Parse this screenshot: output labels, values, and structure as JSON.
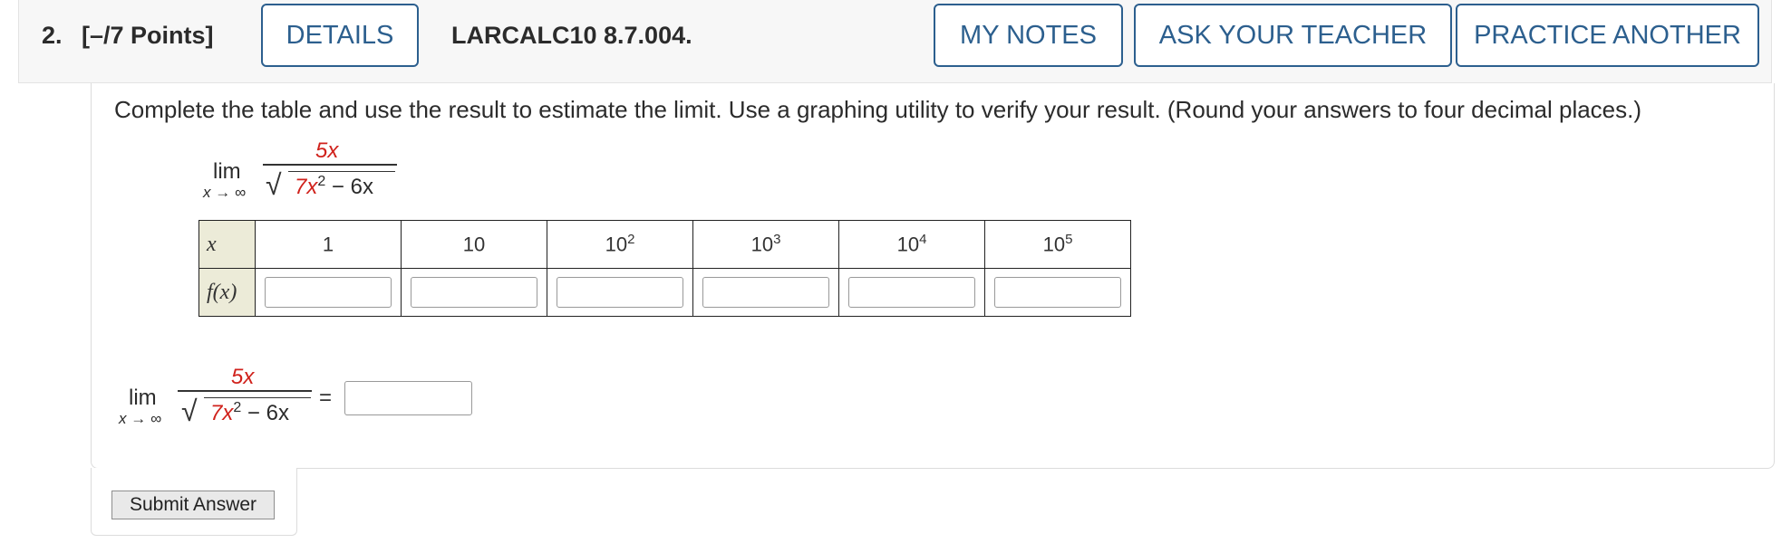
{
  "header": {
    "question_number": "2.",
    "points": "[–/7 Points]",
    "details_label": "DETAILS",
    "problem_code": "LARCALC10 8.7.004.",
    "my_notes_label": "MY NOTES",
    "ask_teacher_label": "ASK YOUR TEACHER",
    "practice_another_label": "PRACTICE ANOTHER"
  },
  "instructions": "Complete the table and use the result to estimate the limit. Use a graphing utility to verify your result. (Round your answers to four decimal places.)",
  "limit": {
    "lim_word": "lim",
    "subscript": "x → ∞",
    "numerator": "5x",
    "den_coeff": "7x",
    "den_power": "2",
    "den_rest": " − 6x",
    "equals": "="
  },
  "table": {
    "x_label": "x",
    "fx_label": "f(x)",
    "columns": [
      {
        "base": "1",
        "exp": ""
      },
      {
        "base": "10",
        "exp": ""
      },
      {
        "base": "10",
        "exp": "2"
      },
      {
        "base": "10",
        "exp": "3"
      },
      {
        "base": "10",
        "exp": "4"
      },
      {
        "base": "10",
        "exp": "5"
      }
    ]
  },
  "submit_label": "Submit Answer",
  "colors": {
    "accent": "#2c5f8e",
    "highlight": "#d0221c",
    "label_bg": "#ecebd8"
  }
}
